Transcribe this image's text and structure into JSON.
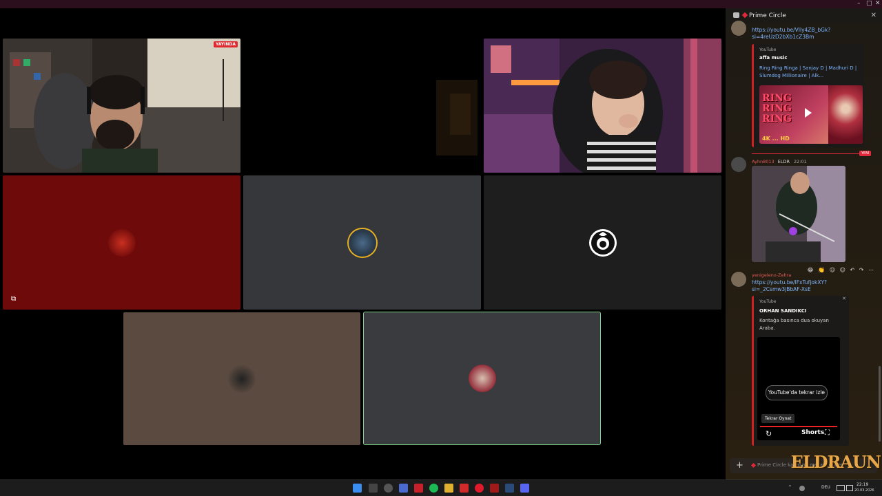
{
  "window": {
    "minimize": "–",
    "maximize": "□",
    "close": "✕"
  },
  "stage": {
    "streamer_badge": "YAYINDA",
    "tiles": [
      {
        "name": "streamer-cam",
        "bg": "#1a1410"
      },
      {
        "name": "empty-cam",
        "bg": "#000000"
      },
      {
        "name": "girl-cam",
        "bg": "#2a1a30"
      },
      {
        "name": "user-red",
        "bg": "#6e0a0a"
      },
      {
        "name": "user-gray1",
        "bg": "#36373b"
      },
      {
        "name": "user-dark",
        "bg": "#1e1e1f"
      },
      {
        "name": "user-brown",
        "bg": "#5a4a40"
      },
      {
        "name": "user-gray2",
        "bg": "#3a3b3f"
      }
    ]
  },
  "chat": {
    "title": "Prime Circle",
    "close": "✕",
    "messages": [
      {
        "link": "https://youtu.be/VIly4ZB_bGk?si=4reUzD2bXb1cZ3Bm",
        "embed": {
          "source": "YouTube",
          "author": "affa music",
          "title": "Ring Ring Ringa | Sanjay D | Madhuri D | Slumdog Millionaire | Alk...",
          "thumb_text": "RING RING RING",
          "thumb_hd": "4K ... HD"
        }
      },
      {
        "user": "Ayhn8013",
        "tag": "ELDR",
        "time": "22:01"
      },
      {
        "user": "yenigelenx-Zehra",
        "link": "https://youtu.be/lFxTufjokXY?si=_2Csmw3jBbAF-XsE",
        "embed": {
          "source": "YouTube",
          "author": "ORHAN SANDIKCI",
          "description": "Kontağa basınca dua okuyan Araba.",
          "close": "✕",
          "replay_pill": "YouTube'da tekrar izle",
          "tooltip": "Tekrar Oynat",
          "shorts": "Shorts",
          "replay_icon": "↻",
          "fullscreen_icon": "⛶"
        }
      }
    ],
    "new_badge": "YENİ",
    "reactions": "😂 👏 ☺ ☺ ↶ ↷ ⋯",
    "composer_placeholder": "Prime Circle kanalına mesaj gönder",
    "composer_plus": "+",
    "watermark": "ELDRAUN"
  },
  "taskbar": {
    "lang": "DEU",
    "time": "22:19",
    "date": "20.03.2026",
    "tray_chevron": "^"
  }
}
